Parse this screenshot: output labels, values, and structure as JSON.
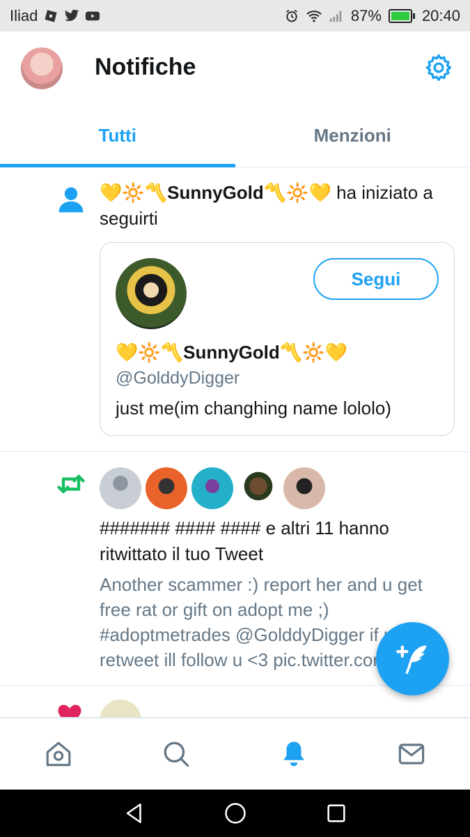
{
  "status_bar": {
    "carrier": "Iliad",
    "battery": "87%",
    "time": "20:40"
  },
  "header": {
    "title": "Notifiche"
  },
  "tabs": [
    {
      "label": "Tutti",
      "active": true
    },
    {
      "label": "Menzioni",
      "active": false
    }
  ],
  "follow_notification": {
    "actor": "💛🔆〽️SunnyGold〽️🔆💛",
    "action": " ha iniziato a seguirti",
    "card": {
      "name": "💛🔆〽️SunnyGold〽️🔆💛",
      "handle": "@GolddyDigger",
      "bio": "just me(im changhing name  lololo)",
      "follow_label": "Segui"
    }
  },
  "retweet_notification": {
    "text": "####### #### #### e altri 11 hanno ritwittato il tuo Tweet",
    "tweet": "Another scammer :) report her and u get free rat or gift on adopt me ;) #adoptmetrades @GolddyDigger if u retweet ill follow u <3 pic.twitter.com/..."
  },
  "colors": {
    "accent": "#1da1f2",
    "retweet": "#17bf63",
    "like": "#e0245e",
    "secondary_text": "#657786"
  },
  "icons": {
    "settings": "gear-icon",
    "follow": "person-icon",
    "retweet": "retweet-icon",
    "like": "heart-icon",
    "compose": "compose-tweet-icon",
    "nav": [
      "home-icon",
      "search-icon",
      "bell-icon",
      "mail-icon"
    ]
  }
}
